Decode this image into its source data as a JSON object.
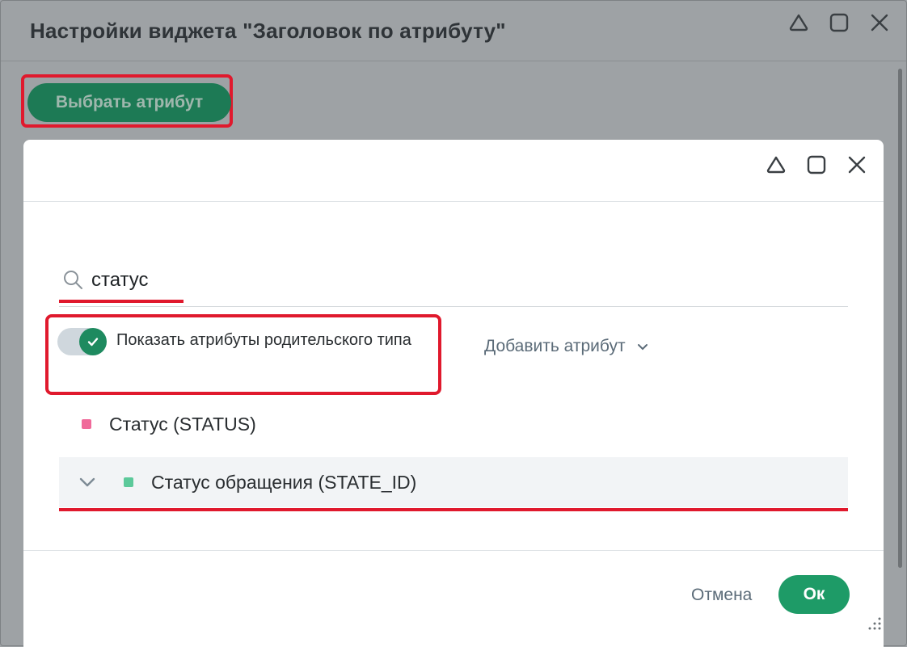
{
  "outer_window": {
    "title": "Настройки виджета \"Заголовок по атрибуту\"",
    "controls": [
      "collapse-icon",
      "maximize-icon",
      "close-icon"
    ],
    "select_attribute_button": "Выбрать атрибут"
  },
  "dialog": {
    "controls": [
      "collapse-icon",
      "maximize-icon",
      "close-icon"
    ],
    "search": {
      "value": "статус",
      "icon": "search-icon"
    },
    "toggle": {
      "label": "Показать атрибуты родительского типа",
      "checked": true
    },
    "add_attribute": {
      "label": "Добавить атрибут",
      "icon": "chevron-down-icon"
    },
    "attributes": [
      {
        "label": "Статус (STATUS)",
        "color": "#f06a9a"
      },
      {
        "label": "Статус обращения (STATE_ID)",
        "color": "#5cc99a",
        "expandable": true
      }
    ],
    "footer": {
      "cancel_label": "Отмена",
      "ok_label": "Ок"
    }
  },
  "colors": {
    "primary_green": "#1e9b67",
    "highlight_red": "#e0192d",
    "overlay_gray": "#9ea2a5"
  }
}
